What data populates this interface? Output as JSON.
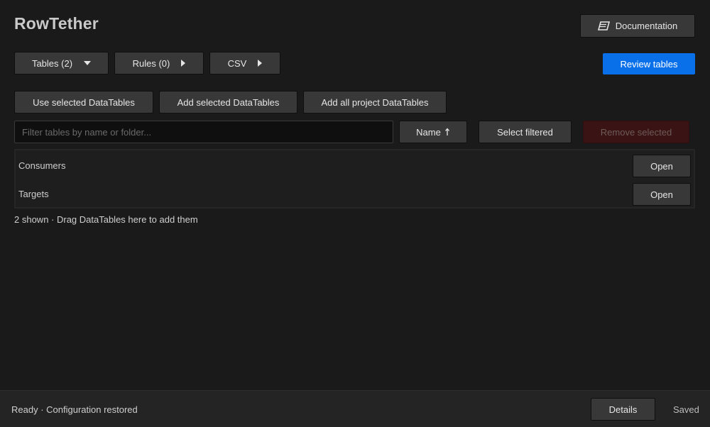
{
  "app": {
    "title": "RowTether"
  },
  "header": {
    "documentation_label": "Documentation",
    "review_label": "Review tables"
  },
  "tabs": [
    {
      "label": "Tables (2)",
      "state": "expanded"
    },
    {
      "label": "Rules (0)",
      "state": "collapsed"
    },
    {
      "label": "CSV",
      "state": "collapsed"
    }
  ],
  "actions": {
    "use_selected": "Use selected DataTables",
    "add_selected": "Add selected DataTables",
    "add_all": "Add all project DataTables"
  },
  "filter": {
    "placeholder": "Filter tables by name or folder...",
    "value": "",
    "sort_label": "Name",
    "select_filtered_label": "Select filtered",
    "remove_selected_label": "Remove selected"
  },
  "tables": [
    {
      "name": "Consumers",
      "open_label": "Open"
    },
    {
      "name": "Targets",
      "open_label": "Open"
    }
  ],
  "hint": "2 shown · Drag DataTables here to add them",
  "status_bar": {
    "message": "Ready · Configuration restored",
    "details_label": "Details",
    "saved_label": "Saved"
  },
  "colors": {
    "background": "#1a1a1a",
    "button": "#383838",
    "primary": "#0a70ea",
    "disabled_danger": "#3a1414"
  }
}
